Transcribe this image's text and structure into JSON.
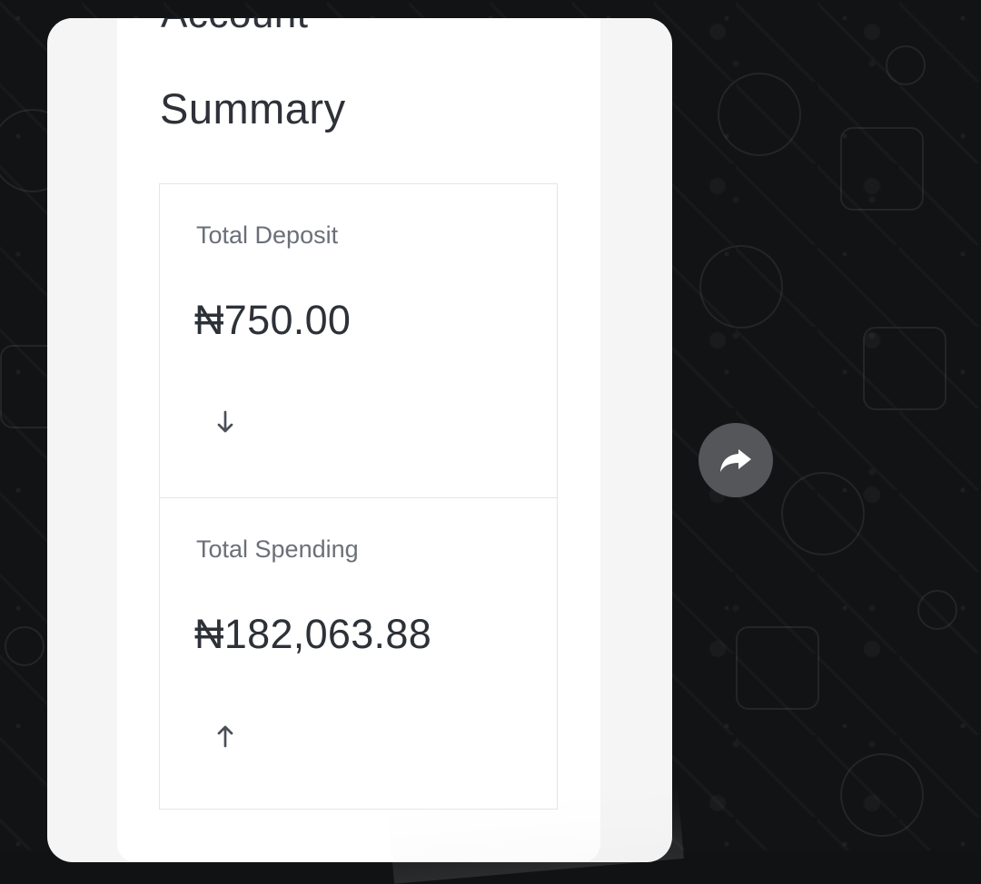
{
  "header": {
    "top_text": "Account",
    "title": "Summary"
  },
  "summary": {
    "deposit": {
      "label": "Total Deposit",
      "amount": "₦750.00",
      "direction_icon": "arrow-down-icon"
    },
    "spending": {
      "label": "Total Spending",
      "amount": "₦182,063.88",
      "direction_icon": "arrow-up-icon"
    }
  },
  "actions": {
    "share_icon": "forward-arrow-icon"
  },
  "colors": {
    "background": "#121315",
    "panel": "#f5f5f5",
    "card": "#ffffff",
    "text_primary": "#2e3138",
    "text_secondary": "#6b6f78",
    "share_button": "#54565a"
  }
}
